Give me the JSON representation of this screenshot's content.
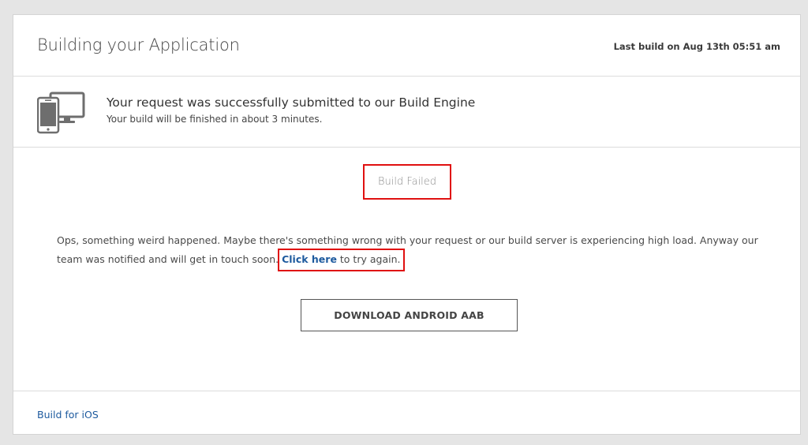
{
  "header": {
    "title": "Building your Application",
    "last_build": "Last build on Aug 13th 05:51 am"
  },
  "submission": {
    "icon": "devices-icon",
    "title": "Your request was successfully submitted to our Build Engine",
    "subtitle": "Your build will be finished in about 3 minutes."
  },
  "status": {
    "text": "Build Failed",
    "highlight_color": "#e01010"
  },
  "message": {
    "line_start": "Ops, something weird happened. Maybe there's something wrong with your request or our build server is experiencing high load. Anyway our team was notified and will get in touch soon.",
    "retry_link": "Click here",
    "retry_suffix": " to try again."
  },
  "actions": {
    "download_label": "DOWNLOAD ANDROID AAB"
  },
  "footer": {
    "ios_link": "Build for iOS"
  },
  "colors": {
    "link": "#1d5a9e",
    "background": "#e5e5e5"
  }
}
